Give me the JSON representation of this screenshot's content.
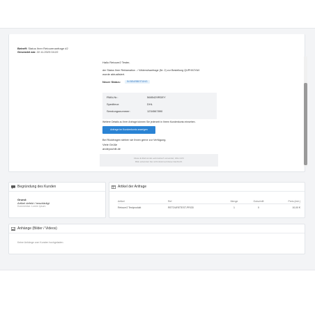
{
  "email_meta": {
    "subject_label": "Betreff:",
    "subject_value": "Status Ihrer Retourenanfrage #2",
    "sent_label": "Gesendet am:",
    "sent_value": "22.11.2023 04:22"
  },
  "email": {
    "greeting": "Hallo Retoure2 Tester,",
    "status_line_1": "der Status Ihrer Reklamation - / Widerrufsanfrage (Nr. 2) zur Bestellung QUPHX2YAX",
    "status_line_2": "wurde aktualisiert.",
    "new_status_label": "Neuer Status:",
    "new_status_value": "IN BEARBEITUNG",
    "info_rows": [
      {
        "label": "RMA-Nr.:",
        "value": "5685429RDEY"
      },
      {
        "label": "Spediteur:",
        "value": "DHL"
      },
      {
        "label": "Sendungsnummer:",
        "value": "1234567890"
      }
    ],
    "details_text": "Weitere Details zu Ihrer Anfrage können Sie jederzeit in Ihrem Kundenkonto einsehen.",
    "button_label": "Anfrage im Kundenkonto anzeigen",
    "closing_1": "Bei Rückfragen stehen wir Ihnen gerne zur Verfügung.",
    "closing_2": "Viele Grüße",
    "closing_3": "andeyouhlit.de",
    "footer_1": "Diese E-Mail wurde automatisch versendet, bitte nicht",
    "footer_2": "Bitte antworten Sie nicht direkt auf diese Nachricht."
  },
  "reason_card": {
    "title": "Begründung des Kunden",
    "field_label": "Grund:",
    "field_value": "Artikel defekt / beschädigt",
    "hint": "Kommentar: Lorem Ipsum"
  },
  "items_card": {
    "title": "Artikel der Anfrage",
    "columns": [
      "Artikel",
      "Ref",
      "Menge",
      "Gutschrift",
      "Preis (inkl.)"
    ],
    "rows": [
      [
        "Retoure2 Testprodukt",
        "RETOURETEST-PROD",
        "1",
        "0",
        "10,00 €"
      ]
    ]
  },
  "attachments_card": {
    "title": "Anhänge (Bilder / Videos)",
    "empty_text": "Keine Anhänge vom Kunden hochgeladen."
  },
  "colors": {
    "accent": "#2a83d4",
    "badge_bg": "#e7f2fb",
    "page_bg": "#f3f4f6"
  }
}
